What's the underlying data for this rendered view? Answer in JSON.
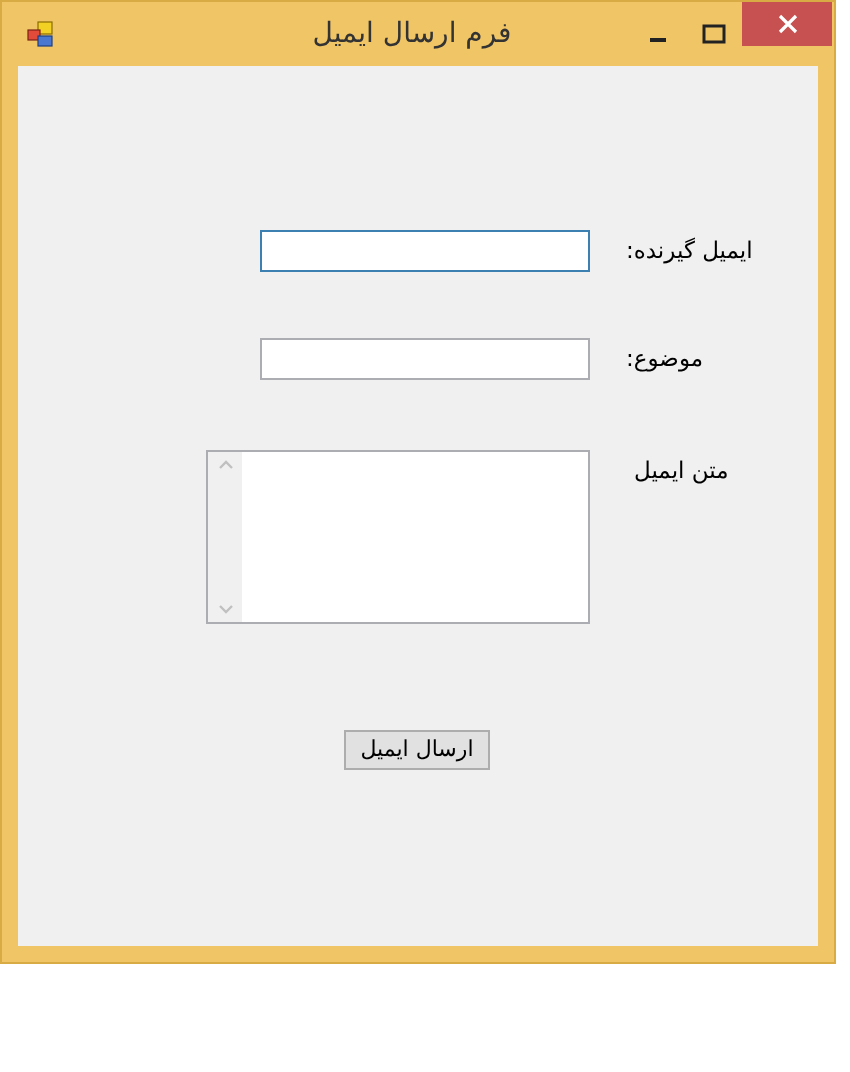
{
  "window": {
    "title": "فرم ارسال ایمیل"
  },
  "fields": [
    {
      "kind": "line",
      "label": "ایمیل گیرنده:",
      "focused": true
    },
    {
      "kind": "line",
      "label": "موضوع:",
      "focused": false
    },
    {
      "kind": "multiline",
      "label": "متن ایمیل",
      "focused": false
    }
  ],
  "button": "ارسال ایمیل"
}
